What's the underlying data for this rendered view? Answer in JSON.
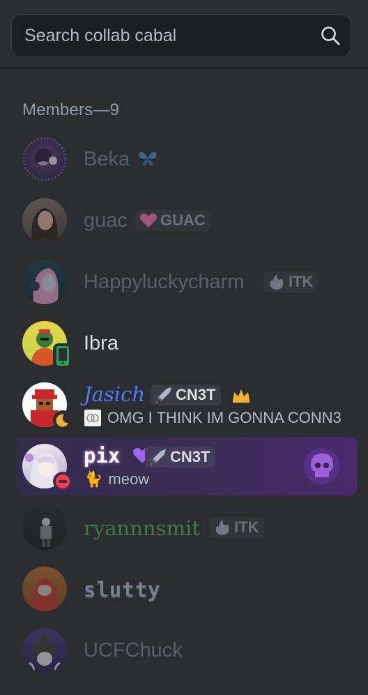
{
  "search": {
    "placeholder": "Search collab cabal"
  },
  "members_header": "Members—9",
  "members": [
    {
      "name": "Beka",
      "emoji": "🦋"
    },
    {
      "name": "guac",
      "tag": "GUAC"
    },
    {
      "name": "Happyluckycharm",
      "tag": "ITK"
    },
    {
      "name": "Ibra"
    },
    {
      "name": "Jasich",
      "tag": "CN3T",
      "status_text": "OMG I THINK IM GONNA CONN3"
    },
    {
      "name": "pix",
      "tag": "CN3T",
      "status_text": "meow",
      "status_emoji": "🐈"
    },
    {
      "name": "ryannnsmit",
      "tag": "ITK"
    },
    {
      "name": "slutty"
    },
    {
      "name": "UCFChuck"
    }
  ],
  "colors": {
    "background": "#2b2d31",
    "dim_name": "#5c5f66",
    "jasich_name": "#4f7cff",
    "pix_name": "#ffffff",
    "ryannnsmit_name": "#3f7a4a",
    "highlight_row": "#3b2c55"
  },
  "icons": {
    "search": "magnifier-icon",
    "butterfly": "butterfly-icon",
    "heart": "heart-icon",
    "flame": "flame-icon",
    "sword": "sword-icon",
    "crown": "crown-icon",
    "mobile": "mobile-status-icon",
    "moon": "idle-moon-icon",
    "dnd": "do-not-disturb-icon",
    "skull": "skull-icon"
  }
}
